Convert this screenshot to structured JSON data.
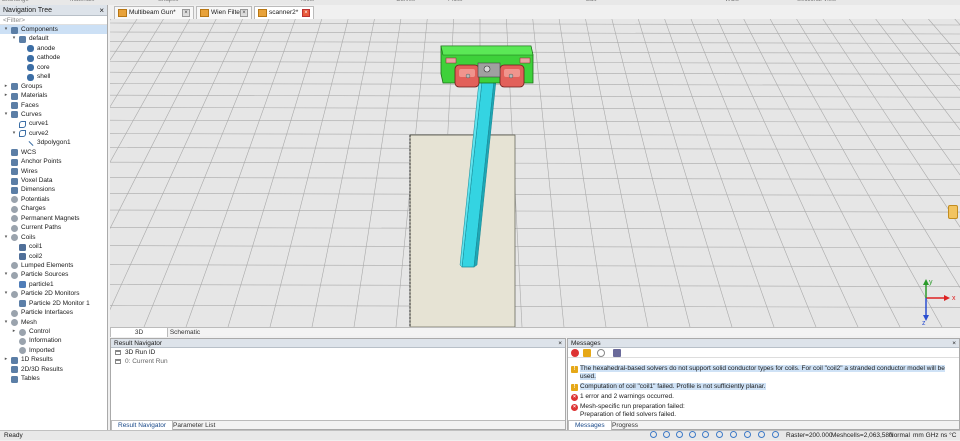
{
  "ribbon_groups": [
    "Exchange",
    "Materials",
    "Shapes",
    "Tools",
    "Curves",
    "Picks",
    "Edit",
    "WCS",
    "Sectional View"
  ],
  "nav": {
    "title": "Navigation Tree",
    "filter_placeholder": "<Filter>",
    "items": [
      {
        "label": "Components",
        "level": 0,
        "toggle": "▾",
        "icon": "folder",
        "selected": true
      },
      {
        "label": "default",
        "level": 1,
        "toggle": "▾",
        "icon": "folder"
      },
      {
        "label": "anode",
        "level": 2,
        "toggle": "",
        "icon": "solid"
      },
      {
        "label": "cathode",
        "level": 2,
        "toggle": "",
        "icon": "solid"
      },
      {
        "label": "core",
        "level": 2,
        "toggle": "",
        "icon": "solid"
      },
      {
        "label": "shell",
        "level": 2,
        "toggle": "",
        "icon": "solid"
      },
      {
        "label": "Groups",
        "level": 0,
        "toggle": "▸",
        "icon": "folder"
      },
      {
        "label": "Materials",
        "level": 0,
        "toggle": "▸",
        "icon": "folder"
      },
      {
        "label": "Faces",
        "level": 0,
        "toggle": "",
        "icon": "folder"
      },
      {
        "label": "Curves",
        "level": 0,
        "toggle": "▾",
        "icon": "folder"
      },
      {
        "label": "curve1",
        "level": 1,
        "toggle": "",
        "icon": "curve"
      },
      {
        "label": "curve2",
        "level": 1,
        "toggle": "▾",
        "icon": "curve"
      },
      {
        "label": "3dpolygon1",
        "level": 2,
        "toggle": "",
        "icon": "line"
      },
      {
        "label": "WCS",
        "level": 0,
        "toggle": "",
        "icon": "folder"
      },
      {
        "label": "Anchor Points",
        "level": 0,
        "toggle": "",
        "icon": "folder"
      },
      {
        "label": "Wires",
        "level": 0,
        "toggle": "",
        "icon": "folder"
      },
      {
        "label": "Voxel Data",
        "level": 0,
        "toggle": "",
        "icon": "folder"
      },
      {
        "label": "Dimensions",
        "level": 0,
        "toggle": "",
        "icon": "folder"
      },
      {
        "label": "Potentials",
        "level": 0,
        "toggle": "",
        "icon": "gear"
      },
      {
        "label": "Charges",
        "level": 0,
        "toggle": "",
        "icon": "gear"
      },
      {
        "label": "Permanent Magnets",
        "level": 0,
        "toggle": "",
        "icon": "gear"
      },
      {
        "label": "Current Paths",
        "level": 0,
        "toggle": "",
        "icon": "gear"
      },
      {
        "label": "Coils",
        "level": 0,
        "toggle": "▾",
        "icon": "gear"
      },
      {
        "label": "coil1",
        "level": 1,
        "toggle": "",
        "icon": "coil"
      },
      {
        "label": "coil2",
        "level": 1,
        "toggle": "",
        "icon": "coil"
      },
      {
        "label": "Lumped Elements",
        "level": 0,
        "toggle": "",
        "icon": "gear"
      },
      {
        "label": "Particle Sources",
        "level": 0,
        "toggle": "▾",
        "icon": "gear"
      },
      {
        "label": "particle1",
        "level": 1,
        "toggle": "",
        "icon": "src"
      },
      {
        "label": "Particle 2D Monitors",
        "level": 0,
        "toggle": "▾",
        "icon": "gear"
      },
      {
        "label": "Particle 2D Monitor 1",
        "level": 1,
        "toggle": "",
        "icon": "mon"
      },
      {
        "label": "Particle Interfaces",
        "level": 0,
        "toggle": "",
        "icon": "gear"
      },
      {
        "label": "Mesh",
        "level": 0,
        "toggle": "▾",
        "icon": "gear"
      },
      {
        "label": "Control",
        "level": 1,
        "toggle": "▸",
        "icon": "gear"
      },
      {
        "label": "Information",
        "level": 1,
        "toggle": "",
        "icon": "gear"
      },
      {
        "label": "Imported",
        "level": 1,
        "toggle": "",
        "icon": "gear"
      },
      {
        "label": "1D Results",
        "level": 0,
        "toggle": "▸",
        "icon": "folder"
      },
      {
        "label": "2D/3D Results",
        "level": 0,
        "toggle": "",
        "icon": "folder"
      },
      {
        "label": "Tables",
        "level": 0,
        "toggle": "",
        "icon": "folder"
      }
    ]
  },
  "doc_tabs": [
    {
      "label": "Multibeam Gun*",
      "active": false
    },
    {
      "label": "Wien Filter*",
      "active": false
    },
    {
      "label": "scanner2*",
      "active": true
    }
  ],
  "view_tabs": [
    "3D",
    "Schematic"
  ],
  "axes": {
    "x": "x",
    "y": "y",
    "z": "z"
  },
  "result_nav": {
    "title": "Result Navigator",
    "rows": [
      {
        "label": "3D Run ID",
        "sub": false
      },
      {
        "label": "0: Current Run",
        "sub": true
      }
    ],
    "tabs": [
      "Result Navigator",
      "Parameter List"
    ]
  },
  "messages": {
    "title": "Messages",
    "items": [
      {
        "type": "warn",
        "text": "The hexahedral-based solvers do not support solid conductor types for coils. For coil \"coil2\" a stranded conductor model will be used.",
        "highlight": true
      },
      {
        "type": "warn",
        "text": "Computation of coil \"coil1\" failed. Profile is not sufficiently planar.",
        "highlight": true
      },
      {
        "type": "err",
        "text": "1 error and 2 warnings occurred.",
        "highlight": false
      },
      {
        "type": "err",
        "text": "Mesh-specific run preparation failed:",
        "highlight": false,
        "detail": "Preparation of field solvers failed."
      }
    ],
    "tabs": [
      "Messages",
      "Progress"
    ]
  },
  "status": {
    "left": "Ready",
    "raster": "Raster=200.000",
    "meshcells": "Meshcells=2,063,580",
    "mode": "Normal",
    "units": "mm  GHz  ns  °C"
  }
}
